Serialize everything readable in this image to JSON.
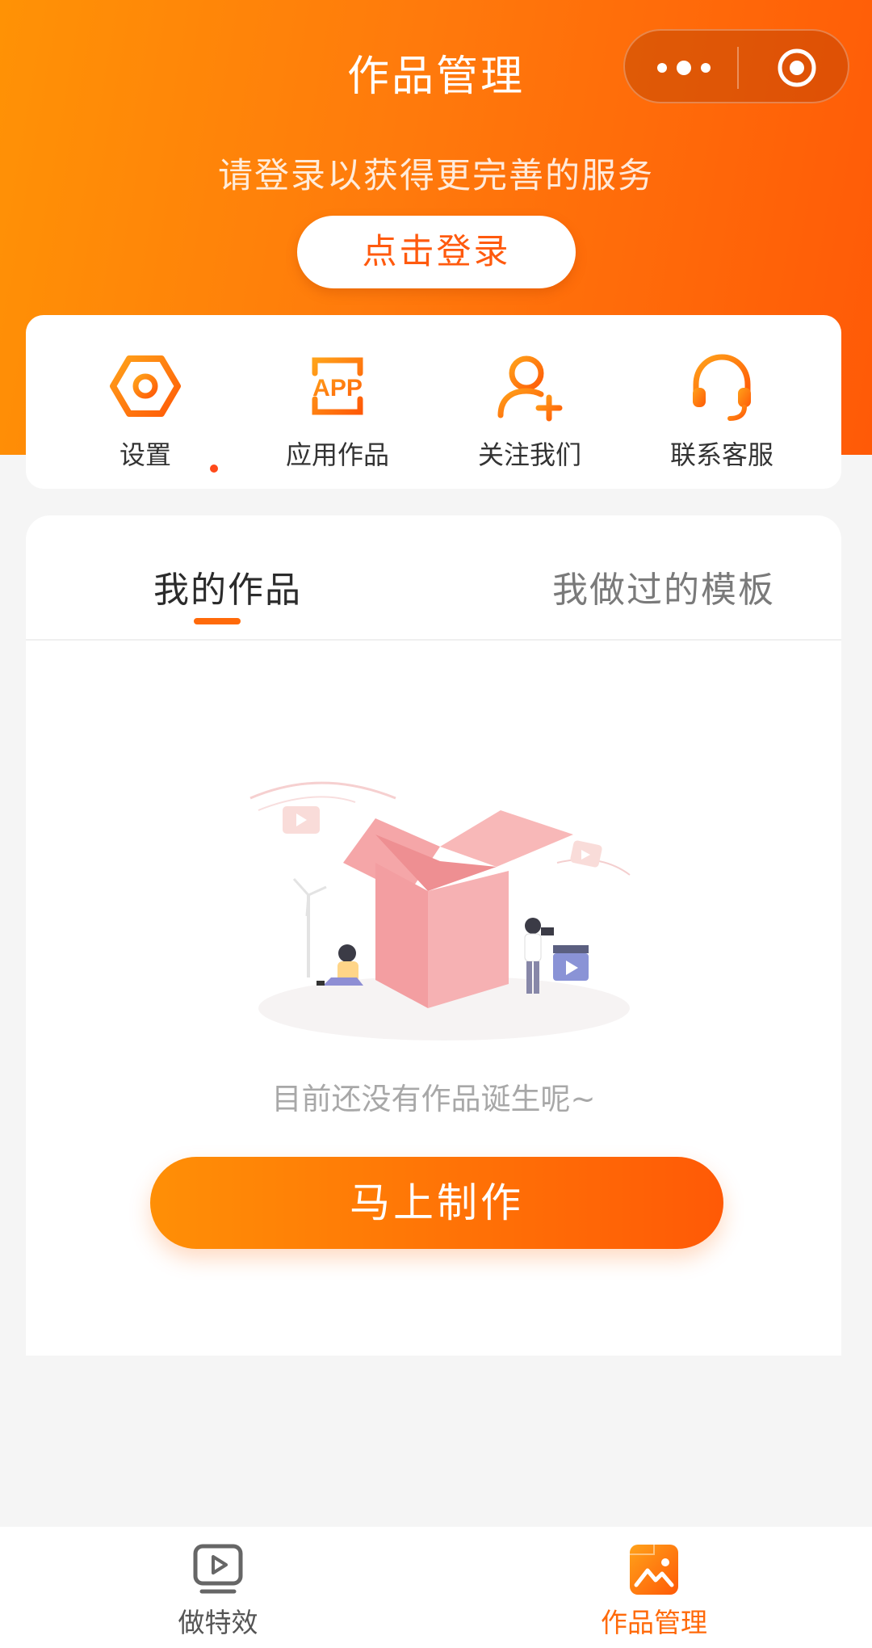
{
  "header": {
    "title": "作品管理",
    "menu_icon": "more-dots-icon",
    "close_icon": "target-circle-icon"
  },
  "login": {
    "hint": "请登录以获得更完善的服务",
    "button_label": "点击登录"
  },
  "quick_actions": [
    {
      "label": "设置",
      "icon": "hexagon-settings-icon",
      "has_badge": true
    },
    {
      "label": "应用作品",
      "icon": "app-icon"
    },
    {
      "label": "关注我们",
      "icon": "add-user-icon"
    },
    {
      "label": "联系客服",
      "icon": "headset-icon"
    }
  ],
  "works": {
    "tabs": [
      {
        "label": "我的作品",
        "active": true
      },
      {
        "label": "我做过的模板",
        "active": false
      }
    ],
    "empty_message": "目前还没有作品诞生呢~",
    "make_button": "马上制作"
  },
  "tabbar": [
    {
      "label": "做特效",
      "icon": "video-play-icon",
      "active": false,
      "color": "#555555"
    },
    {
      "label": "作品管理",
      "icon": "gallery-image-icon",
      "active": true,
      "color": "#ff6a0a"
    }
  ],
  "colors": {
    "accent": "#ff6a0a",
    "gradient_start": "#ff9205",
    "gradient_end": "#ff5a07"
  }
}
